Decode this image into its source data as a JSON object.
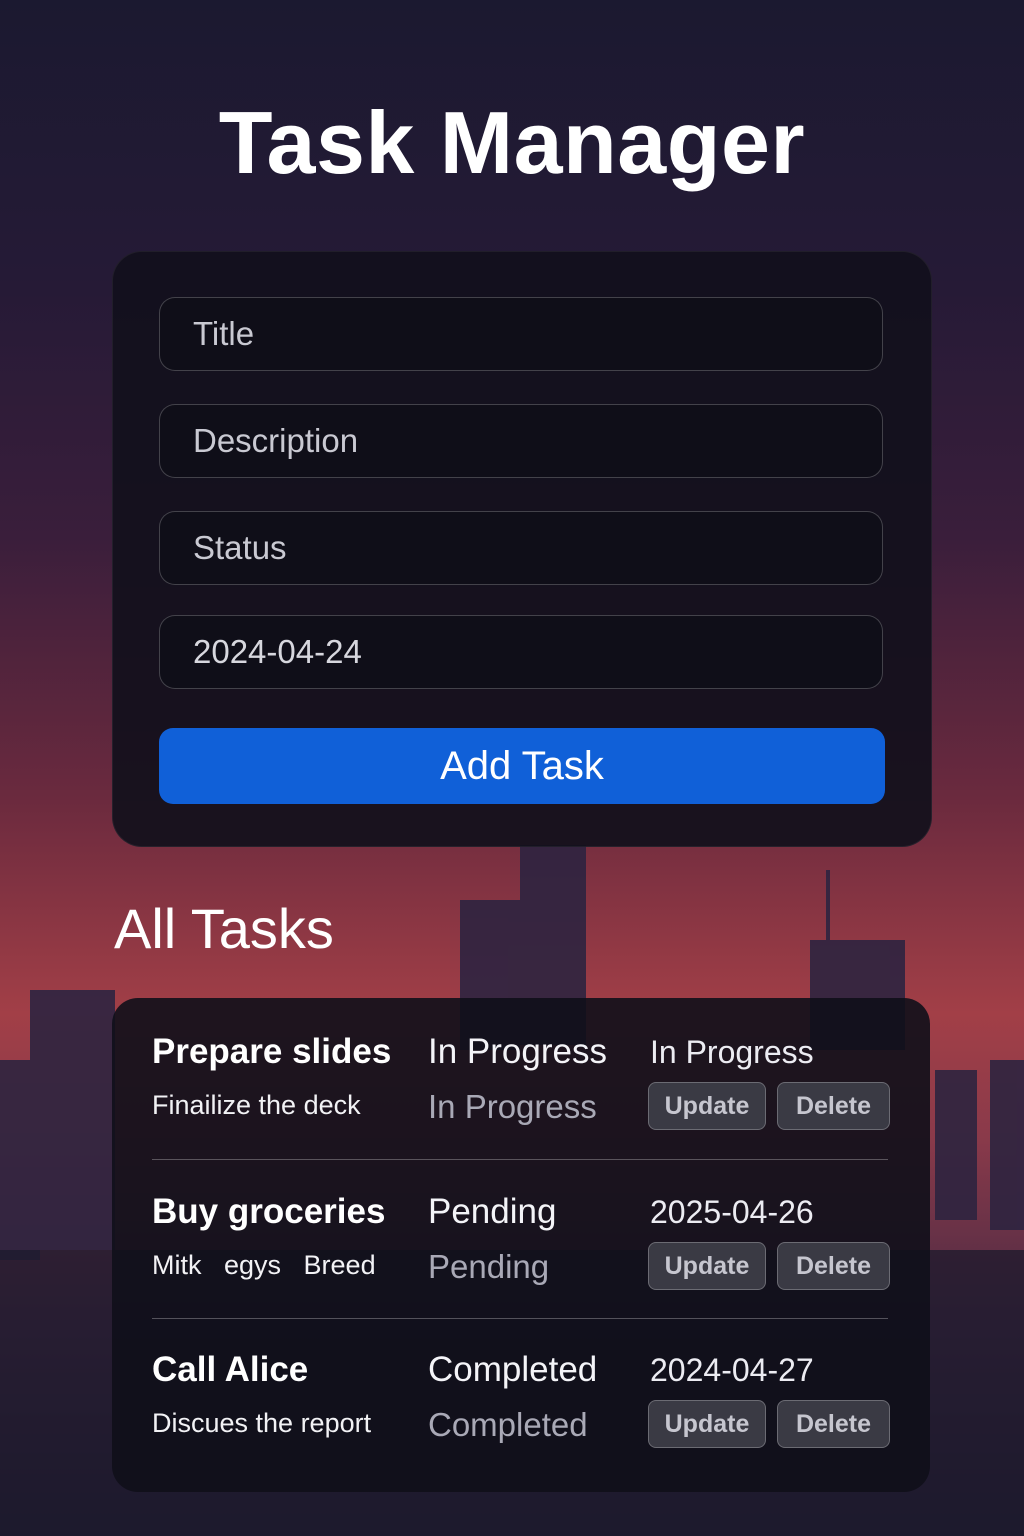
{
  "app": {
    "title": "Task Manager"
  },
  "form": {
    "title_placeholder": "Title",
    "description_placeholder": "Description",
    "status_placeholder": "Status",
    "date_value": "2024-04-24",
    "submit_label": "Add Task"
  },
  "list": {
    "heading": "All Tasks",
    "tasks": [
      {
        "title": "Prepare slides",
        "description": "Finailize the deck",
        "status": "In Progress",
        "status_secondary": "In Progress",
        "meta": "In Progress",
        "update_label": "Update",
        "delete_label": "Delete"
      },
      {
        "title": "Buy groceries",
        "description": "Mitk   egys   Breed",
        "status": "Pending",
        "status_secondary": "Pending",
        "meta": "2025-04-26",
        "update_label": "Update",
        "delete_label": "Delete"
      },
      {
        "title": "Call Alice",
        "description": "Discues the report",
        "status": "Completed",
        "status_secondary": "Completed",
        "meta": "2024-04-27",
        "update_label": "Update",
        "delete_label": "Delete"
      }
    ]
  },
  "colors": {
    "accent": "#1060d8",
    "card_bg": "#12101c",
    "button_bg": "#3a3a44"
  }
}
